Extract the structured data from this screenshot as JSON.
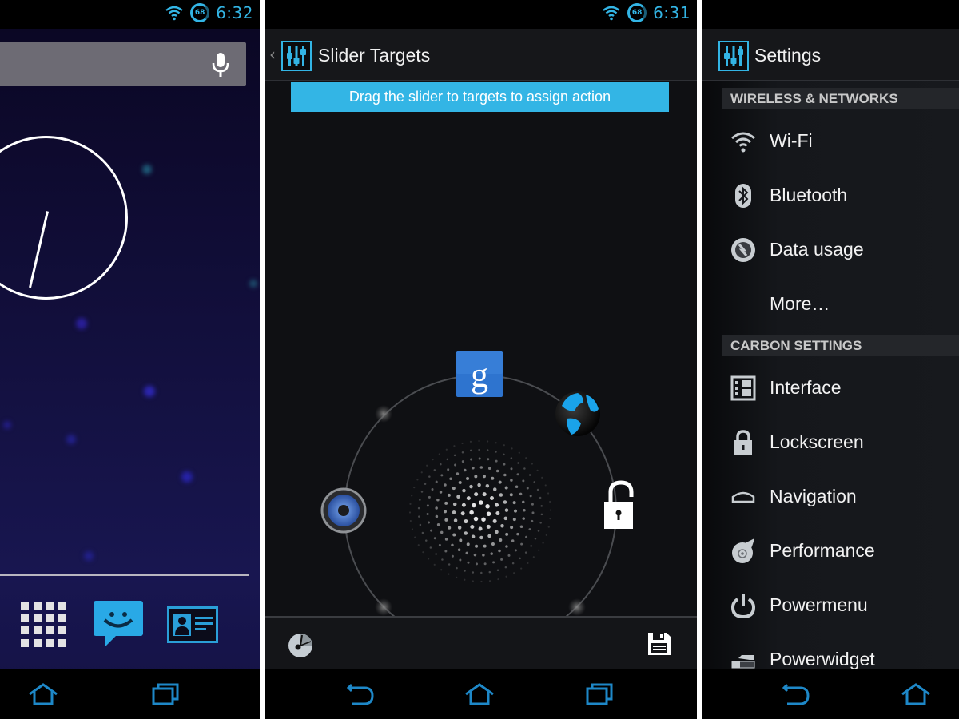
{
  "colors": {
    "accent": "#33b5e5",
    "nav_icon": "#1e88c8",
    "home_bg": "#141244",
    "dark_bg": "#0f1013",
    "section_header_bg": "#24262a",
    "text_primary": "#f2f2f2",
    "text_section": "#c9c9c9"
  },
  "home_screen": {
    "status": {
      "time": "6:32",
      "battery_level": "68",
      "wifi_icon": "wifi-icon"
    },
    "search_bar": {
      "mic_icon": "microphone-icon"
    },
    "clock_widget": {
      "type": "analog-clock"
    },
    "dock": [
      {
        "name": "app-drawer",
        "icon": "grid-icon"
      },
      {
        "name": "messaging",
        "icon": "smiley-speech-bubble-icon"
      },
      {
        "name": "contacts",
        "icon": "contact-card-icon"
      }
    ],
    "navbar": [
      {
        "name": "home",
        "icon": "home-icon"
      },
      {
        "name": "recent-apps",
        "icon": "recent-apps-icon"
      }
    ]
  },
  "slider_screen": {
    "status": {
      "time": "6:31",
      "battery_level": "68",
      "wifi_icon": "wifi-icon"
    },
    "action_bar": {
      "back_glyph": "‹",
      "title": "Slider Targets",
      "icon": "equalizer-sliders-icon"
    },
    "hint": "Drag the slider to targets to assign action",
    "targets": [
      {
        "name": "google-search",
        "icon": "google-g-icon",
        "angle_deg": 90,
        "assigned": true
      },
      {
        "name": "browser",
        "icon": "globe-icon",
        "angle_deg": 45,
        "assigned": true
      },
      {
        "name": "unlock",
        "icon": "unlock-icon",
        "angle_deg": 0,
        "assigned": true
      },
      {
        "name": "empty-bottom-right",
        "icon": "empty-target-dot",
        "angle_deg": -45,
        "assigned": false
      },
      {
        "name": "empty-bottom-left",
        "icon": "empty-target-dot",
        "angle_deg": -135,
        "assigned": false
      },
      {
        "name": "sound",
        "icon": "speaker-icon",
        "angle_deg": 180,
        "assigned": true
      },
      {
        "name": "empty-top-left",
        "icon": "empty-target-dot",
        "angle_deg": 135,
        "assigned": false
      }
    ],
    "bottom_bar": {
      "left_icon": "timer-icon",
      "right_icon": "save-icon"
    },
    "navbar": [
      {
        "name": "back",
        "icon": "back-icon"
      },
      {
        "name": "home",
        "icon": "home-icon"
      },
      {
        "name": "recent-apps",
        "icon": "recent-apps-icon"
      }
    ]
  },
  "settings_screen": {
    "action_bar": {
      "title": "Settings",
      "icon": "equalizer-sliders-icon"
    },
    "sections": [
      {
        "header": "WIRELESS & NETWORKS",
        "items": [
          {
            "label": "Wi-Fi",
            "icon": "wifi-icon"
          },
          {
            "label": "Bluetooth",
            "icon": "bluetooth-icon"
          },
          {
            "label": "Data usage",
            "icon": "data-usage-icon"
          },
          {
            "label": "More…",
            "icon": ""
          }
        ]
      },
      {
        "header": "CARBON SETTINGS",
        "items": [
          {
            "label": "Interface",
            "icon": "interface-icon"
          },
          {
            "label": "Lockscreen",
            "icon": "lock-icon"
          },
          {
            "label": "Navigation",
            "icon": "navigation-bar-icon"
          },
          {
            "label": "Performance",
            "icon": "performance-icon"
          },
          {
            "label": "Powermenu",
            "icon": "power-icon"
          },
          {
            "label": "Powerwidget",
            "icon": "powerwidget-icon"
          }
        ]
      }
    ],
    "navbar": [
      {
        "name": "back",
        "icon": "back-icon"
      },
      {
        "name": "home",
        "icon": "home-icon"
      }
    ]
  }
}
